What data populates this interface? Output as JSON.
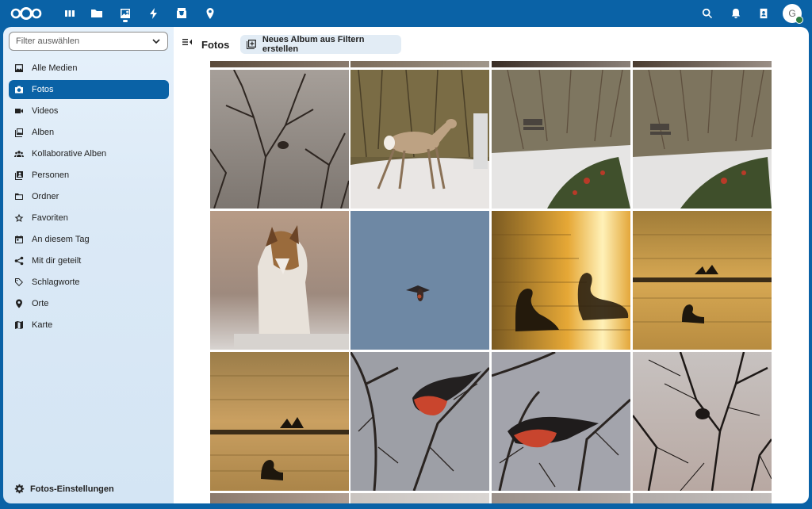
{
  "sidebar": {
    "filter_placeholder": "Filter auswählen",
    "items": [
      {
        "label": "Alle Medien"
      },
      {
        "label": "Fotos"
      },
      {
        "label": "Videos"
      },
      {
        "label": "Alben"
      },
      {
        "label": "Kollaborative Alben"
      },
      {
        "label": "Personen"
      },
      {
        "label": "Ordner"
      },
      {
        "label": "Favoriten"
      },
      {
        "label": "An diesem Tag"
      },
      {
        "label": "Mit dir geteilt"
      },
      {
        "label": "Schlagworte"
      },
      {
        "label": "Orte"
      },
      {
        "label": "Karte"
      }
    ],
    "active_item": "Fotos",
    "settings_label": "Fotos-Einstellungen"
  },
  "header": {
    "user_initial": "G",
    "accent_color": "#0a62a6"
  },
  "main": {
    "title": "Fotos",
    "create_album_label": "Neues Album aus Filtern erstellen"
  },
  "photos": [
    {
      "subject": "bare-branches-bird"
    },
    {
      "subject": "roe-deer-snow"
    },
    {
      "subject": "bench-snow-bushes"
    },
    {
      "subject": "bench-snow-bushes-2"
    },
    {
      "subject": "collie-dog"
    },
    {
      "subject": "bird-flying-blue-sky"
    },
    {
      "subject": "swans-golden-water"
    },
    {
      "subject": "cormorant-golden-water"
    },
    {
      "subject": "cormorant-swan-golden-water"
    },
    {
      "subject": "bullfinch-branch"
    },
    {
      "subject": "bullfinch-branch-2"
    },
    {
      "subject": "bird-in-bare-tree"
    }
  ]
}
